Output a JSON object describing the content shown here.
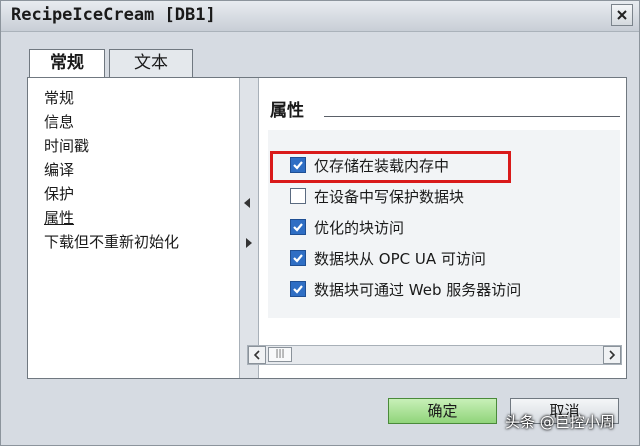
{
  "window": {
    "title": "RecipeIceCream [DB1]"
  },
  "tabs": [
    {
      "label": "常规",
      "active": true
    },
    {
      "label": "文本",
      "active": false
    }
  ],
  "nav": {
    "items": [
      {
        "label": "常规"
      },
      {
        "label": "信息"
      },
      {
        "label": "时间戳"
      },
      {
        "label": "编译"
      },
      {
        "label": "保护"
      },
      {
        "label": "属性",
        "selected": true
      },
      {
        "label": "下载但不重新初始化"
      }
    ]
  },
  "section": {
    "title": "属性"
  },
  "options": [
    {
      "label": "仅存储在装载内存中",
      "checked": true,
      "highlighted": true
    },
    {
      "label": "在设备中写保护数据块",
      "checked": false
    },
    {
      "label": "优化的块访问",
      "checked": true
    },
    {
      "label": "数据块从 OPC UA 可访问",
      "checked": true
    },
    {
      "label": "数据块可通过 Web 服务器访问",
      "checked": true
    }
  ],
  "buttons": {
    "ok": "确定",
    "cancel": "取消"
  },
  "watermark": "头条 @巨控小周",
  "colors": {
    "highlight": "#d91a1a",
    "checkbox": "#2f6ec4",
    "ok_button": "#90d47a"
  }
}
